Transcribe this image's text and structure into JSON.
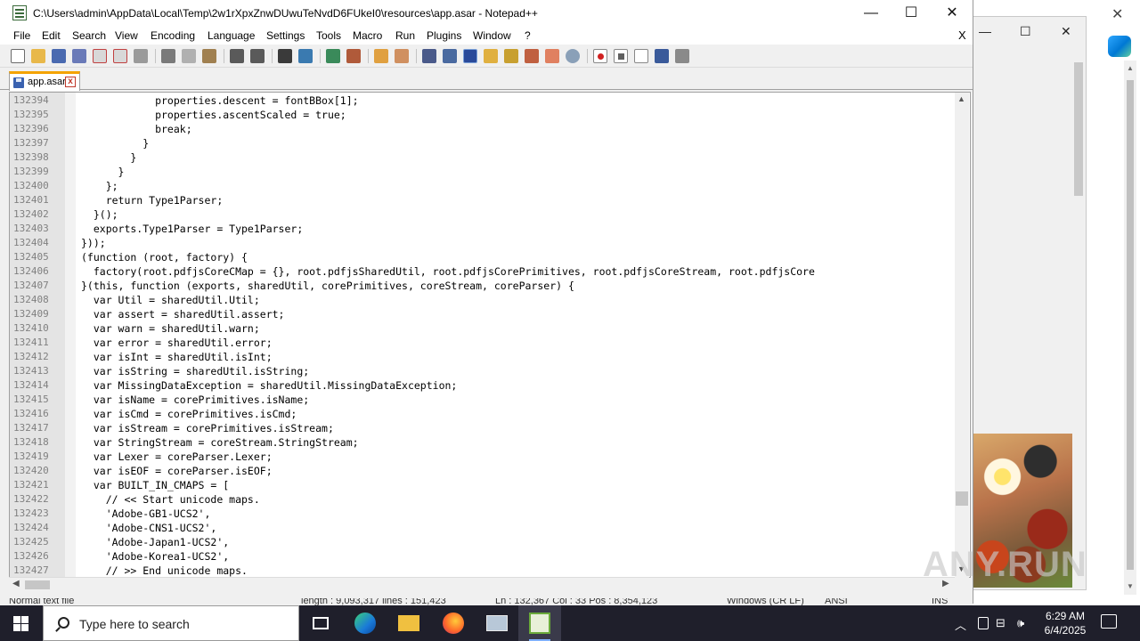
{
  "background_window": {
    "minimize": "—",
    "maximize": "☐",
    "close": "✕"
  },
  "right_strip": {
    "close": "✕"
  },
  "watermark": "ANY.RUN",
  "window": {
    "title": "C:\\Users\\admin\\AppData\\Local\\Temp\\2w1rXpxZnwDUwuTeNvdD6FUkeI0\\resources\\app.asar - Notepad++",
    "minimize": "—",
    "maximize": "☐",
    "close": "✕"
  },
  "menu": {
    "items": [
      "File",
      "Edit",
      "Search",
      "View",
      "Encoding",
      "Language",
      "Settings",
      "Tools",
      "Macro",
      "Run",
      "Plugins",
      "Window",
      "?"
    ],
    "close_doc": "X"
  },
  "toolbar": {
    "icons": [
      "new-file-icon",
      "open-file-icon",
      "save-icon",
      "save-all-icon",
      "close-icon",
      "close-all-icon",
      "print-icon",
      "cut-icon",
      "copy-icon",
      "paste-icon",
      "undo-icon",
      "redo-icon",
      "find-icon",
      "replace-icon",
      "zoom-in-icon",
      "zoom-out-icon",
      "sync-vertical-icon",
      "sync-horizontal-icon",
      "word-wrap-icon",
      "show-all-chars-icon",
      "indent-guide-icon",
      "udl-icon",
      "doc-map-icon",
      "function-list-icon",
      "folder-workspace-icon",
      "monitoring-icon",
      "record-macro-icon",
      "stop-record-icon",
      "play-macro-icon",
      "run-macro-multiple-icon",
      "save-macro-icon"
    ]
  },
  "tabs": [
    {
      "label": "app.asar",
      "close": "x"
    }
  ],
  "editor": {
    "lines": [
      {
        "n": "132394",
        "code": "            properties.descent = fontBBox[1];"
      },
      {
        "n": "132395",
        "code": "            properties.ascentScaled = true;"
      },
      {
        "n": "132396",
        "code": "            break;"
      },
      {
        "n": "132397",
        "code": "          }"
      },
      {
        "n": "132398",
        "code": "        }"
      },
      {
        "n": "132399",
        "code": "      }"
      },
      {
        "n": "132400",
        "code": "    };"
      },
      {
        "n": "132401",
        "code": "    return Type1Parser;"
      },
      {
        "n": "132402",
        "code": "  }();"
      },
      {
        "n": "132403",
        "code": "  exports.Type1Parser = Type1Parser;"
      },
      {
        "n": "132404",
        "code": "}));"
      },
      {
        "n": "132405",
        "code": "(function (root, factory) {"
      },
      {
        "n": "132406",
        "code": "  factory(root.pdfjsCoreCMap = {}, root.pdfjsSharedUtil, root.pdfjsCorePrimitives, root.pdfjsCoreStream, root.pdfjsCore"
      },
      {
        "n": "132407",
        "code": "}(this, function (exports, sharedUtil, corePrimitives, coreStream, coreParser) {"
      },
      {
        "n": "132408",
        "code": "  var Util = sharedUtil.Util;"
      },
      {
        "n": "132409",
        "code": "  var assert = sharedUtil.assert;"
      },
      {
        "n": "132410",
        "code": "  var warn = sharedUtil.warn;"
      },
      {
        "n": "132411",
        "code": "  var error = sharedUtil.error;"
      },
      {
        "n": "132412",
        "code": "  var isInt = sharedUtil.isInt;"
      },
      {
        "n": "132413",
        "code": "  var isString = sharedUtil.isString;"
      },
      {
        "n": "132414",
        "code": "  var MissingDataException = sharedUtil.MissingDataException;"
      },
      {
        "n": "132415",
        "code": "  var isName = corePrimitives.isName;"
      },
      {
        "n": "132416",
        "code": "  var isCmd = corePrimitives.isCmd;"
      },
      {
        "n": "132417",
        "code": "  var isStream = corePrimitives.isStream;"
      },
      {
        "n": "132418",
        "code": "  var StringStream = coreStream.StringStream;"
      },
      {
        "n": "132419",
        "code": "  var Lexer = coreParser.Lexer;"
      },
      {
        "n": "132420",
        "code": "  var isEOF = coreParser.isEOF;"
      },
      {
        "n": "132421",
        "code": "  var BUILT_IN_CMAPS = ["
      },
      {
        "n": "132422",
        "code": "    // << Start unicode maps."
      },
      {
        "n": "132423",
        "code": "    'Adobe-GB1-UCS2',"
      },
      {
        "n": "132424",
        "code": "    'Adobe-CNS1-UCS2',"
      },
      {
        "n": "132425",
        "code": "    'Adobe-Japan1-UCS2',"
      },
      {
        "n": "132426",
        "code": "    'Adobe-Korea1-UCS2',"
      },
      {
        "n": "132427",
        "code": "    // >> End unicode maps."
      }
    ]
  },
  "statusbar": {
    "file_type": "Normal text file",
    "length": "length : 9,093,317    lines : 151,423",
    "position": "Ln : 132,367    Col : 33    Pos : 8,354,123",
    "eol": "Windows (CR LF)",
    "encoding": "ANSI",
    "mode": "INS"
  },
  "taskbar": {
    "search_placeholder": "Type here to search",
    "apps": [
      "task-view-icon",
      "edge-icon",
      "file-explorer-icon",
      "firefox-icon",
      "remote-desktop-icon",
      "notepad-plus-plus-icon"
    ],
    "tray": {
      "chevron": "︿",
      "network": "⊟",
      "volume": "🕪"
    },
    "time": "6:29 AM",
    "date": "6/4/2025"
  }
}
